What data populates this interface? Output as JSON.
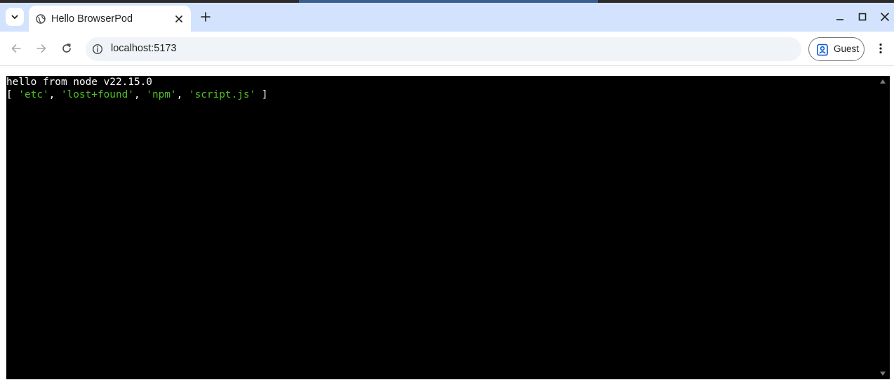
{
  "browser": {
    "tab": {
      "title": "Hello BrowserPod",
      "favicon": "globe-icon"
    },
    "omnibox": {
      "url": "localhost:5173",
      "info_icon": "info-icon"
    },
    "profile": {
      "label": "Guest",
      "icon": "person-icon"
    },
    "colors": {
      "tabstrip_bg": "#d3e3fd",
      "omnibox_bg": "#f0f4f9"
    }
  },
  "terminal": {
    "line1": "hello from node v22.15.0",
    "line2": {
      "open": "[ ",
      "items": [
        "'etc'",
        "'lost+found'",
        "'npm'",
        "'script.js'"
      ],
      "sep": ", ",
      "close": " ]"
    },
    "colors": {
      "background": "#000000",
      "text": "#ffffff",
      "string": "#4fbf26"
    }
  }
}
